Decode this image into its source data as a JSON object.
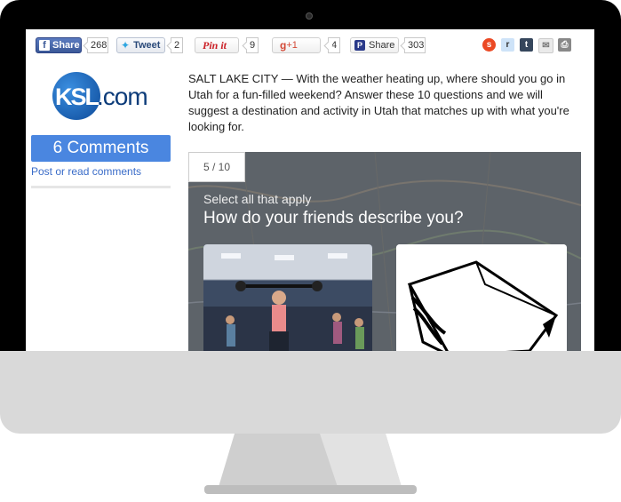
{
  "share_bar": {
    "facebook": {
      "label": "Share",
      "count": "268"
    },
    "twitter": {
      "label": "Tweet",
      "count": "2"
    },
    "pinterest": {
      "label": "Pin it",
      "count": "9"
    },
    "gplus": {
      "label": "+1",
      "count": "4"
    },
    "pocket": {
      "label": "Share",
      "count": "303"
    }
  },
  "sidebar": {
    "logo_left": "KSL",
    "logo_right": ".com",
    "comments_button": "6 Comments",
    "comments_link": "Post or read comments"
  },
  "article": {
    "intro": "SALT LAKE CITY — With the weather heating up, where should you go in Utah for a fun-filled weekend? Answer these 10 questions and we will suggest a destination and activity in Utah that matches up with what you're looking for."
  },
  "quiz": {
    "progress": "5 / 10",
    "instruction": "Select all that apply",
    "question": "How do your friends describe you?"
  }
}
